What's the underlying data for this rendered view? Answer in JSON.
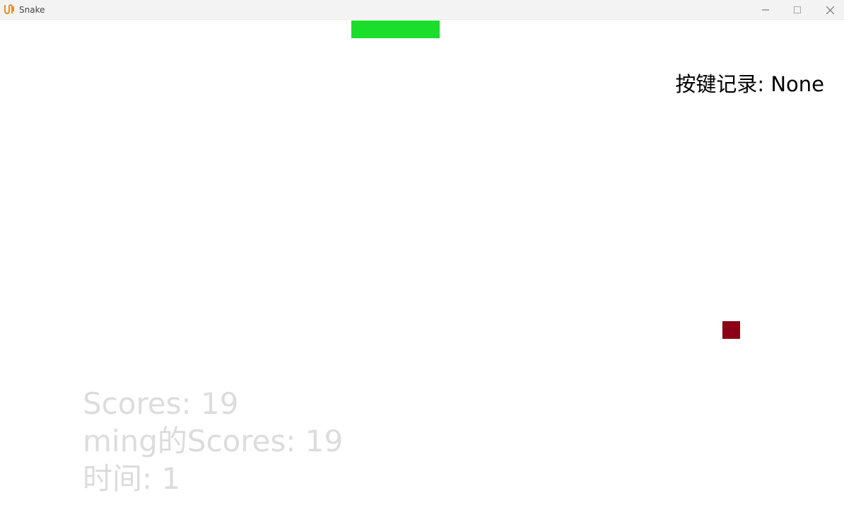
{
  "window": {
    "title": "Snake",
    "icon": "snake-app-icon"
  },
  "controls": {
    "minimize_icon": "minimize-icon",
    "maximize_icon": "maximize-icon",
    "close_icon": "close-icon"
  },
  "game": {
    "background": "#ffffff",
    "snake_color": "#1bdd2b",
    "food_color": "#8c0016",
    "key_record": "按键记录: None",
    "scores": "Scores: 19",
    "player_scores": "ming的Scores: 19",
    "time": "时间: 1"
  }
}
